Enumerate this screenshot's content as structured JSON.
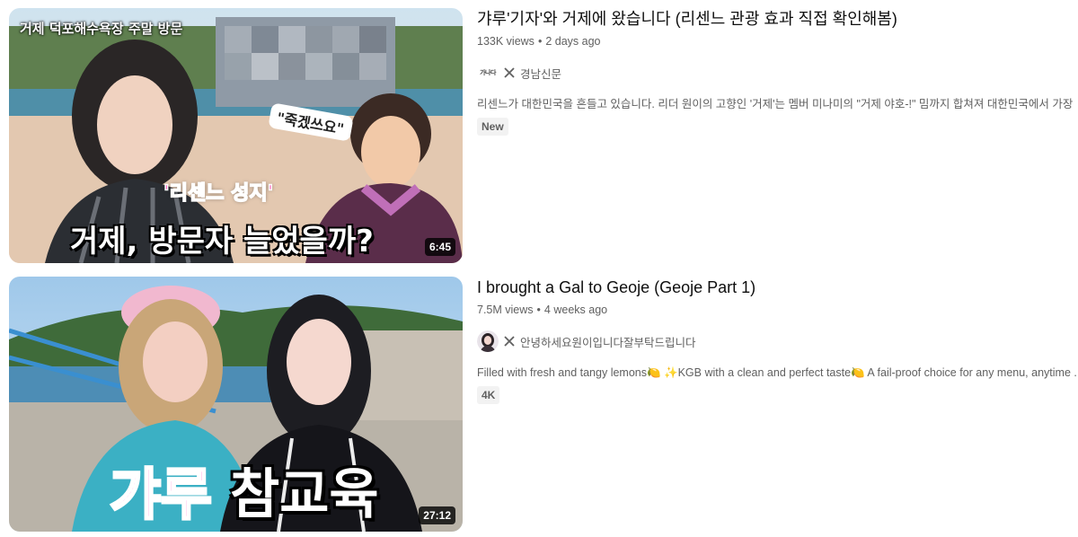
{
  "videos": [
    {
      "title": "갸루'기자'와 거제에 왔습니다 (리센느 관광 효과 직접 확인해봄)",
      "views": "133K views",
      "age": "2 days ago",
      "channel_logo_text": "가나다",
      "channel": "경남신문",
      "description": "리센느가 대한민국을 흔들고 있습니다. 리더 원이의 고향인 '거제'는 멤버 미나미의 \"거제 야호-!\" 밈까지 합쳐져 대한민국에서 가장 ...",
      "tag": "New",
      "duration": "6:45",
      "thumb_text": {
        "top": "거제 덕포해수욕장 주말 방문",
        "quote": "\"죽겠쓰요\"",
        "badge": "'리센느 성지'",
        "main": "거제, 방문자 늘었을까?"
      }
    },
    {
      "title": "I brought a Gal to Geoje (Geoje Part 1)",
      "views": "7.5M views",
      "age": "4 weeks ago",
      "channel": "안녕하세요원이입니다잘부탁드립니다",
      "description": "Filled with fresh and tangy lemons🍋 ✨KGB with a clean and perfect taste🍋   A fail-proof choice for any menu, anytime ...",
      "tag": "4K",
      "duration": "27:12",
      "thumb_text": {
        "pink": "갸루",
        "white": "참교육"
      }
    }
  ],
  "icons": {
    "collab": "close-x-icon",
    "more": "none"
  },
  "colors": {
    "meta": "#606060",
    "title": "#0f0f0f",
    "tag_bg": "#f2f2f2"
  }
}
